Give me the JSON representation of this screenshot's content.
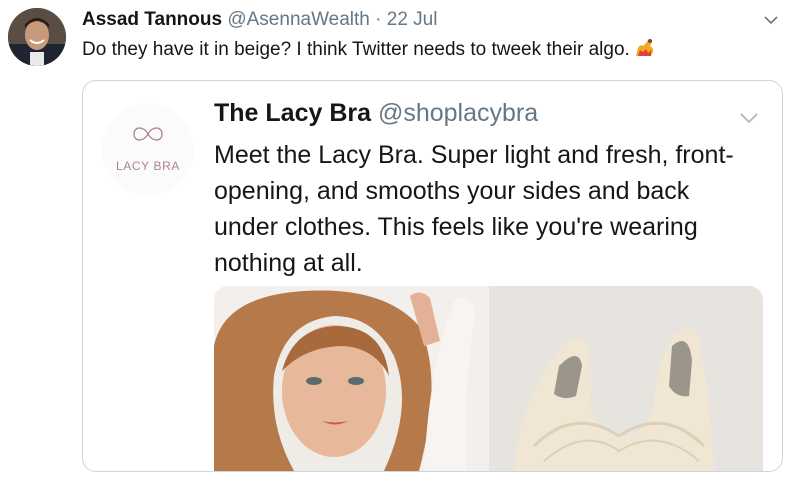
{
  "tweet": {
    "author_name": "Assad Tannous",
    "author_handle": "@AsennaWealth",
    "separator": "·",
    "date": "22 Jul",
    "text": "Do they have it in beige? I think Twitter needs to tweek their algo.",
    "emoji_icon": "flexed-arm-icon"
  },
  "quoted": {
    "author_name": "The Lacy Bra",
    "author_handle": "@shoplacybra",
    "avatar_logo_text": "LACY BRA",
    "text": "Meet the Lacy Bra. Super light and fresh, front-opening, and smooths your sides and back under clothes. This feels like you're wearing nothing at all."
  },
  "colors": {
    "name": "#14171a",
    "secondary": "#657786",
    "border": "#ccd6dd",
    "logo": "#b08096"
  }
}
